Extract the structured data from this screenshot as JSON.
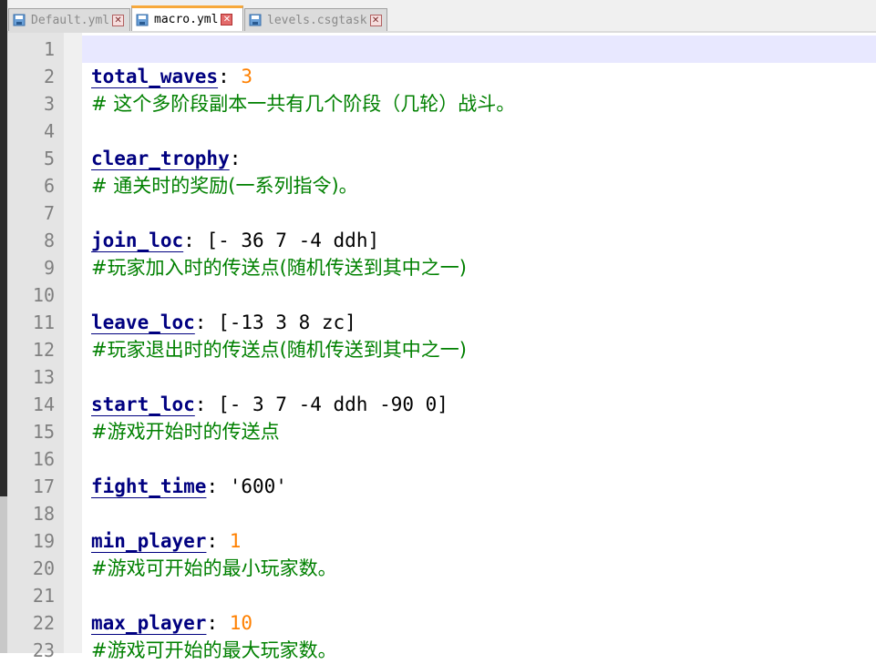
{
  "tabs": [
    {
      "name": "Default.yml",
      "active": false
    },
    {
      "name": "macro.yml",
      "active": true
    },
    {
      "name": "levels.csgtask",
      "active": false
    }
  ],
  "editor": {
    "lines": [
      {
        "num": "1"
      },
      {
        "num": "2",
        "key": "total_waves",
        "sep": ": ",
        "value": "3",
        "value_type": "number"
      },
      {
        "num": "3",
        "comment": "# 这个多阶段副本一共有几个阶段（几轮）战斗。"
      },
      {
        "num": "4"
      },
      {
        "num": "5",
        "key": "clear_trophy",
        "sep": ":"
      },
      {
        "num": "6",
        "comment": "# 通关时的奖励(一系列指令)。"
      },
      {
        "num": "7"
      },
      {
        "num": "8",
        "key": "join_loc",
        "sep": ": ",
        "value": "[- 36 7 -4 ddh]",
        "value_type": "plain"
      },
      {
        "num": "9",
        "comment": "#玩家加入时的传送点(随机传送到其中之一)"
      },
      {
        "num": "10"
      },
      {
        "num": "11",
        "key": "leave_loc",
        "sep": ": ",
        "value": "[-13 3 8 zc]",
        "value_type": "plain"
      },
      {
        "num": "12",
        "comment": "#玩家退出时的传送点(随机传送到其中之一)"
      },
      {
        "num": "13"
      },
      {
        "num": "14",
        "key": "start_loc",
        "sep": ": ",
        "value": "[- 3 7 -4 ddh -90 0]",
        "value_type": "plain"
      },
      {
        "num": "15",
        "comment": "#游戏开始时的传送点"
      },
      {
        "num": "16"
      },
      {
        "num": "17",
        "key": "fight_time",
        "sep": ": ",
        "value": "'600'",
        "value_type": "string"
      },
      {
        "num": "18"
      },
      {
        "num": "19",
        "key": "min_player",
        "sep": ": ",
        "value": "1",
        "value_type": "number"
      },
      {
        "num": "20",
        "comment": "#游戏可开始的最小玩家数。"
      },
      {
        "num": "21"
      },
      {
        "num": "22",
        "key": "max_player",
        "sep": ": ",
        "value": "10",
        "value_type": "number"
      },
      {
        "num": "23",
        "comment": "#游戏可开始的最大玩家数。"
      }
    ]
  },
  "colors": {
    "key": "#000080",
    "number": "#ff8000",
    "comment": "#008000",
    "line_number": "#808080",
    "current_line": "#e8e8ff",
    "active_tab_accent": "#f7a83a"
  }
}
